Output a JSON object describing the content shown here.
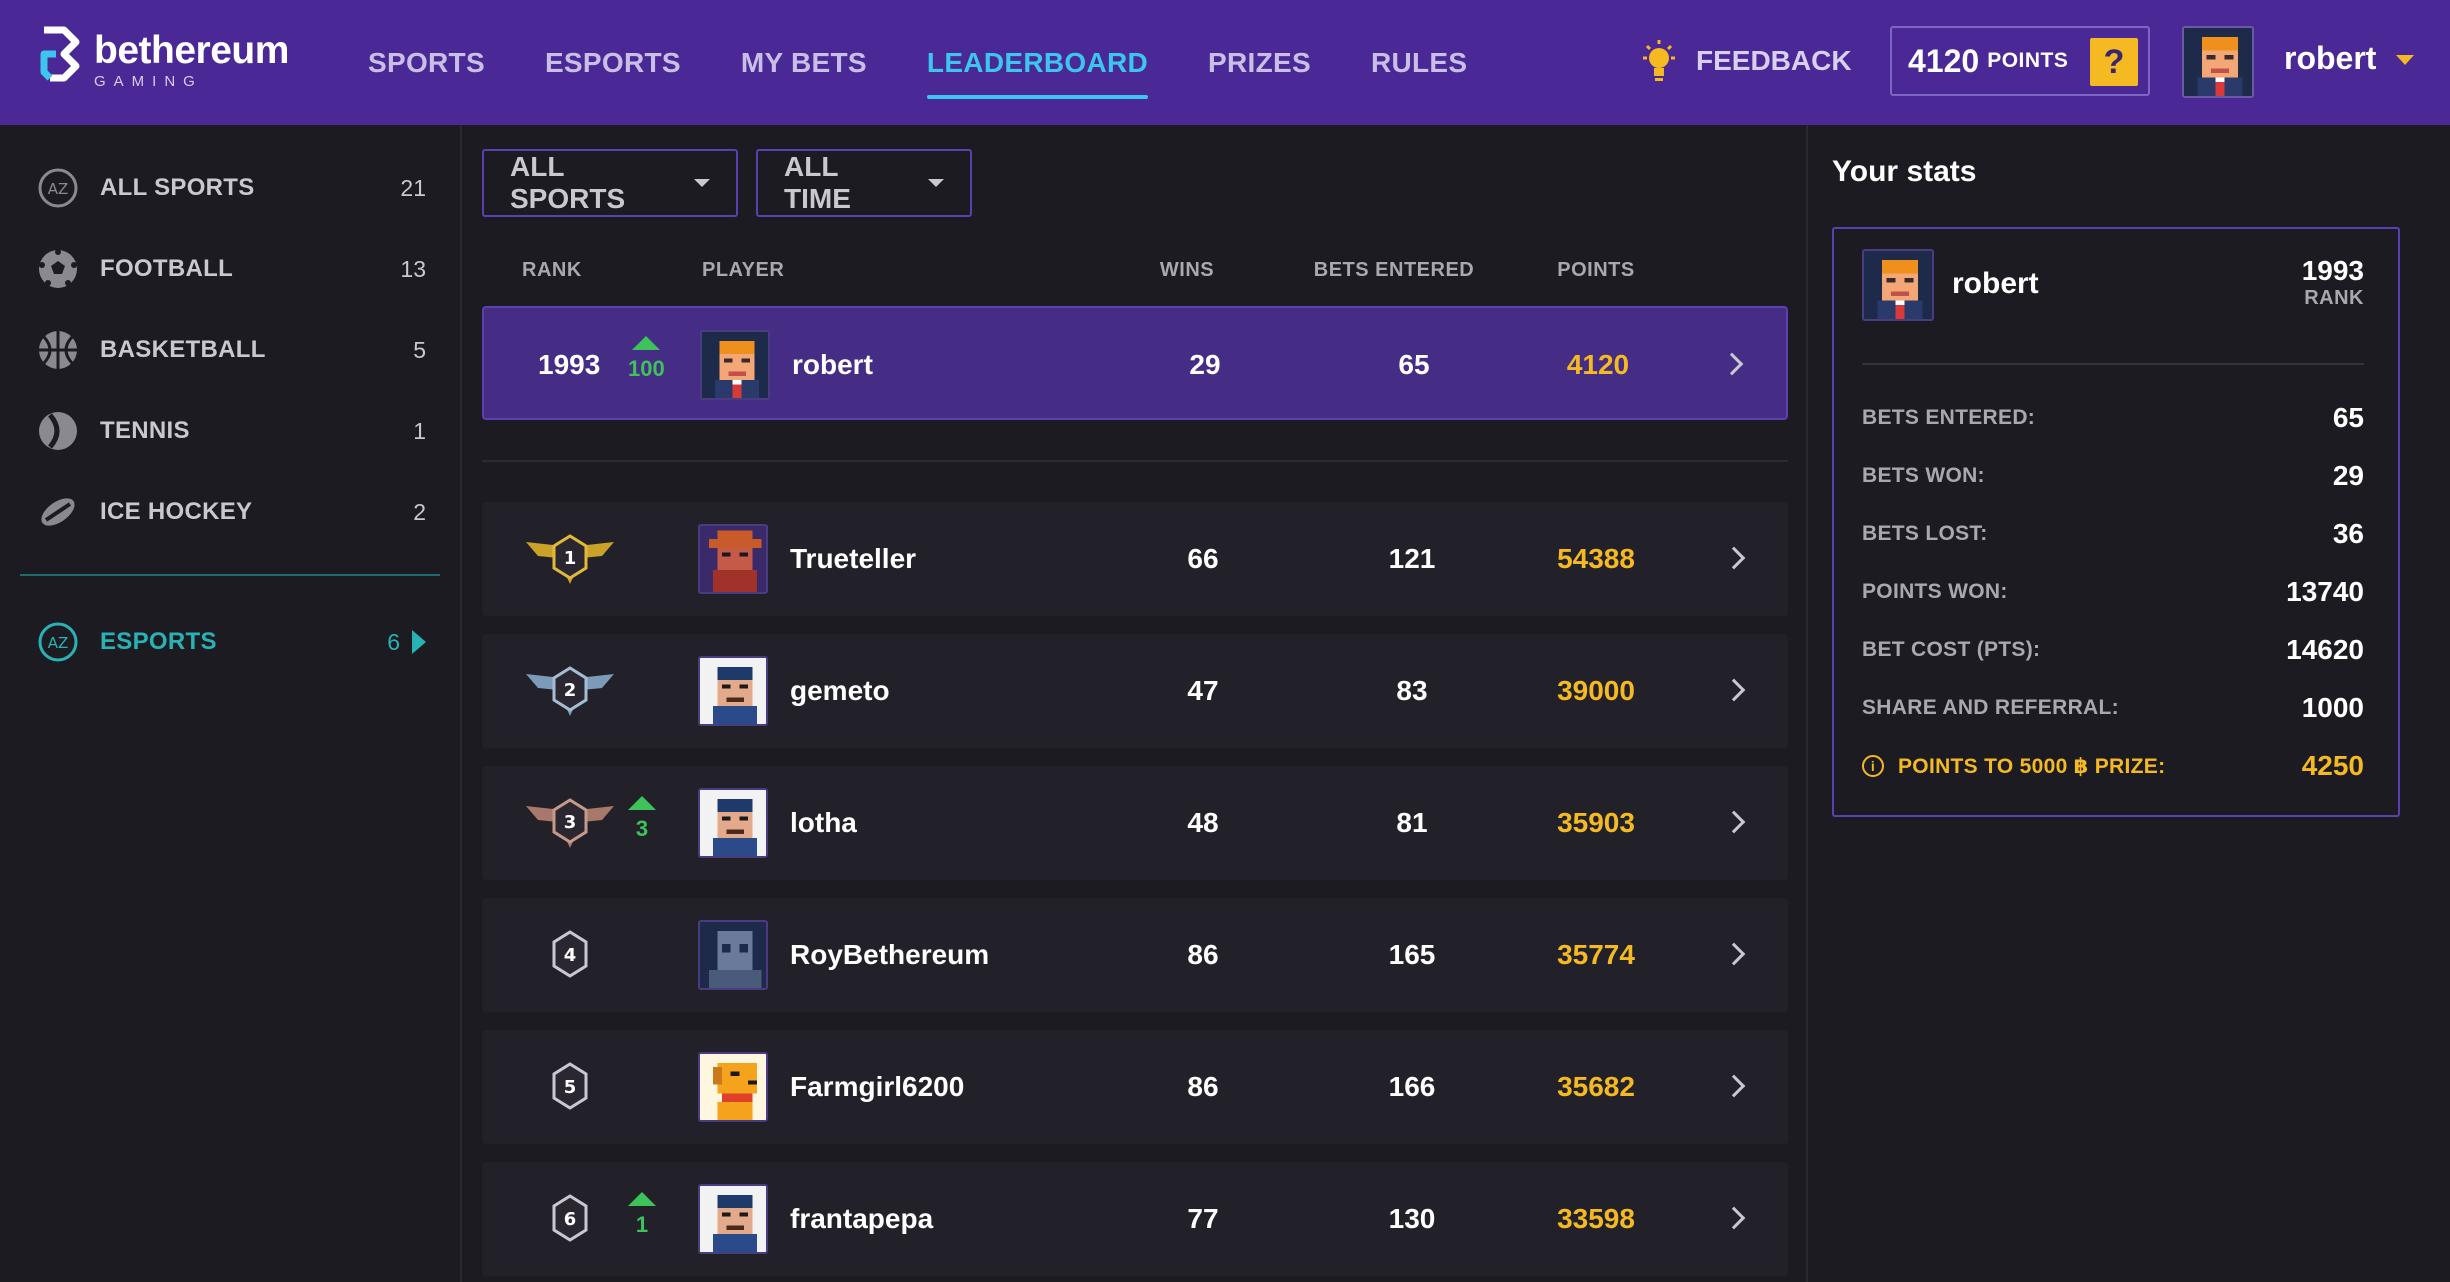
{
  "brand": {
    "name": "bethereum",
    "sub": "GAMING"
  },
  "nav": [
    {
      "label": "SPORTS",
      "active": false
    },
    {
      "label": "ESPORTS",
      "active": false
    },
    {
      "label": "MY BETS",
      "active": false
    },
    {
      "label": "LEADERBOARD",
      "active": true
    },
    {
      "label": "PRIZES",
      "active": false
    },
    {
      "label": "RULES",
      "active": false
    }
  ],
  "header": {
    "feedback": "FEEDBACK",
    "points_value": "4120",
    "points_unit": "POINTS",
    "help": "?",
    "username": "robert"
  },
  "sidebar": {
    "items": [
      {
        "label": "ALL SPORTS",
        "count": "21",
        "icon": "az-icon"
      },
      {
        "label": "FOOTBALL",
        "count": "13",
        "icon": "football-icon"
      },
      {
        "label": "BASKETBALL",
        "count": "5",
        "icon": "basketball-icon"
      },
      {
        "label": "TENNIS",
        "count": "1",
        "icon": "tennis-icon"
      },
      {
        "label": "ICE HOCKEY",
        "count": "2",
        "icon": "ice-hockey-icon"
      }
    ],
    "esports": {
      "label": "ESPORTS",
      "count": "6",
      "icon": "az-icon"
    }
  },
  "filters": {
    "sport": "ALL SPORTS",
    "time": "ALL TIME"
  },
  "table": {
    "headers": {
      "rank": "RANK",
      "player": "PLAYER",
      "wins": "WINS",
      "bets": "BETS ENTERED",
      "points": "POINTS"
    },
    "me": {
      "rank": "1993",
      "move": "100",
      "name": "robert",
      "wins": "29",
      "bets": "65",
      "points": "4120"
    },
    "rows": [
      {
        "rank": "1",
        "move": "",
        "name": "Trueteller",
        "wins": "66",
        "bets": "121",
        "points": "54388"
      },
      {
        "rank": "2",
        "move": "",
        "name": "gemeto",
        "wins": "47",
        "bets": "83",
        "points": "39000"
      },
      {
        "rank": "3",
        "move": "3",
        "name": "lotha",
        "wins": "48",
        "bets": "81",
        "points": "35903"
      },
      {
        "rank": "4",
        "move": "",
        "name": "RoyBethereum",
        "wins": "86",
        "bets": "165",
        "points": "35774"
      },
      {
        "rank": "5",
        "move": "",
        "name": "Farmgirl6200",
        "wins": "86",
        "bets": "166",
        "points": "35682"
      },
      {
        "rank": "6",
        "move": "1",
        "name": "frantapepa",
        "wins": "77",
        "bets": "130",
        "points": "33598"
      }
    ]
  },
  "stats": {
    "title": "Your stats",
    "name": "robert",
    "rank_value": "1993",
    "rank_label": "RANK",
    "items": [
      {
        "label": "BETS ENTERED:",
        "value": "65"
      },
      {
        "label": "BETS WON:",
        "value": "29"
      },
      {
        "label": "BETS LOST:",
        "value": "36"
      },
      {
        "label": "POINTS WON:",
        "value": "13740"
      },
      {
        "label": "BET COST (PTS):",
        "value": "14620"
      },
      {
        "label": "SHARE AND REFERRAL:",
        "value": "1000"
      }
    ],
    "prize": {
      "label": "POINTS TO 5000 ฿ PRIZE:",
      "value": "4250"
    }
  },
  "colors": {
    "header": "#4a2895",
    "accent": "#3cc6ee",
    "gold": "#f5b921",
    "teal": "#28b2b6",
    "up": "#3ec25a",
    "me_row": "#452d85"
  }
}
